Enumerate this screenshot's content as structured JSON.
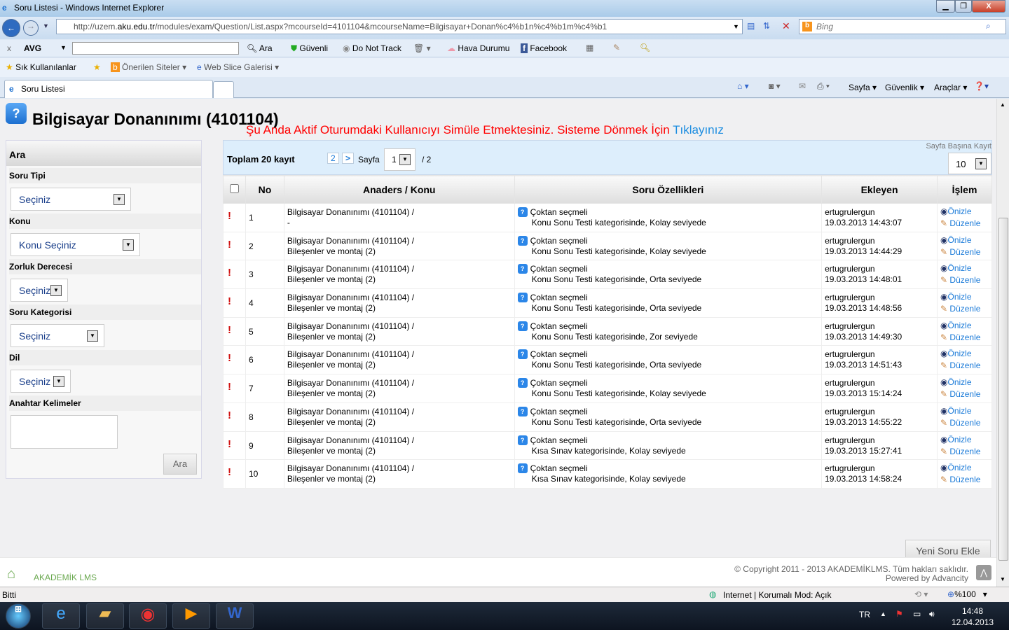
{
  "window": {
    "title": "Soru Listesi - Windows Internet Explorer",
    "url_pre": "http://uzem.",
    "url_host": "aku.edu.tr",
    "url_post": "/modules/exam/Question/List.aspx?mcourseId=4101104&mcourseName=Bilgisayar+Donan%c4%b1n%c4%b1m%c4%b1",
    "search_placeholder": "Bing"
  },
  "avgbar": {
    "close": "x",
    "brand": "AVG",
    "search": "Ara",
    "safe": "Güvenli",
    "dnt": "Do Not Track",
    "weather": "Hava Durumu",
    "facebook": "Facebook"
  },
  "favbar": {
    "favorites": "Sık Kullanılanlar",
    "suggested": "Önerilen Siteler",
    "webslice": "Web Slice Galerisi"
  },
  "tabbar": {
    "tab": "Soru Listesi",
    "page": "Sayfa",
    "security": "Güvenlik",
    "tools": "Araçlar"
  },
  "page": {
    "title": "Bilgisayar Donanınımı (4101104)",
    "warning": "Şu Anda Aktif Oturumdaki Kullanıcıyı Simüle Etmektesiniz. Sisteme Dönmek İçin ",
    "warning_link": "Tıklayınız"
  },
  "search": {
    "header": "Ara",
    "fields": [
      {
        "label": "Soru Tipi",
        "value": "Seçiniz"
      },
      {
        "label": "Konu",
        "value": "Konu Seçiniz"
      },
      {
        "label": "Zorluk Derecesi",
        "value": "Seçiniz"
      },
      {
        "label": "Soru Kategorisi",
        "value": "Seçiniz"
      },
      {
        "label": "Dil",
        "value": "Seçiniz"
      }
    ],
    "keywords_label": "Anahtar Kelimeler",
    "keywords_value": "",
    "button": "Ara"
  },
  "pager": {
    "total": "Toplam 20 kayıt",
    "page_link": "2",
    "next": ">",
    "page_label": "Sayfa",
    "current_page": "1",
    "of": "/ 2",
    "per_page_label": "Sayfa Başına Kayıt",
    "per_page": "10"
  },
  "table": {
    "headers": [
      "No",
      "Anaders / Konu",
      "Soru Özellikleri",
      "Ekleyen",
      "İşlem"
    ],
    "rows": [
      {
        "no": "1",
        "course": "Bilgisayar Donanınımı (4101104) /",
        "topic": "-",
        "type": "Çoktan seçmeli",
        "props": "Konu Sonu Testi kategorisinde, Kolay seviyede",
        "user": "ertugrulergun",
        "date": "19.03.2013 14:43:07"
      },
      {
        "no": "2",
        "course": "Bilgisayar Donanınımı (4101104) /",
        "topic": "Bileşenler ve montaj (2)",
        "type": "Çoktan seçmeli",
        "props": "Konu Sonu Testi kategorisinde, Kolay seviyede",
        "user": "ertugrulergun",
        "date": "19.03.2013 14:44:29"
      },
      {
        "no": "3",
        "course": "Bilgisayar Donanınımı (4101104) /",
        "topic": "Bileşenler ve montaj (2)",
        "type": "Çoktan seçmeli",
        "props": "Konu Sonu Testi kategorisinde, Orta seviyede",
        "user": "ertugrulergun",
        "date": "19.03.2013 14:48:01"
      },
      {
        "no": "4",
        "course": "Bilgisayar Donanınımı (4101104) /",
        "topic": "Bileşenler ve montaj (2)",
        "type": "Çoktan seçmeli",
        "props": "Konu Sonu Testi kategorisinde, Orta seviyede",
        "user": "ertugrulergun",
        "date": "19.03.2013 14:48:56"
      },
      {
        "no": "5",
        "course": "Bilgisayar Donanınımı (4101104) /",
        "topic": "Bileşenler ve montaj (2)",
        "type": "Çoktan seçmeli",
        "props": "Konu Sonu Testi kategorisinde, Zor seviyede",
        "user": "ertugrulergun",
        "date": "19.03.2013 14:49:30"
      },
      {
        "no": "6",
        "course": "Bilgisayar Donanınımı (4101104) /",
        "topic": "Bileşenler ve montaj (2)",
        "type": "Çoktan seçmeli",
        "props": "Konu Sonu Testi kategorisinde, Orta seviyede",
        "user": "ertugrulergun",
        "date": "19.03.2013 14:51:43"
      },
      {
        "no": "7",
        "course": "Bilgisayar Donanınımı (4101104) /",
        "topic": "Bileşenler ve montaj (2)",
        "type": "Çoktan seçmeli",
        "props": "Konu Sonu Testi kategorisinde, Kolay seviyede",
        "user": "ertugrulergun",
        "date": "19.03.2013 15:14:24"
      },
      {
        "no": "8",
        "course": "Bilgisayar Donanınımı (4101104) /",
        "topic": "Bileşenler ve montaj (2)",
        "type": "Çoktan seçmeli",
        "props": "Konu Sonu Testi kategorisinde, Orta seviyede",
        "user": "ertugrulergun",
        "date": "19.03.2013 14:55:22"
      },
      {
        "no": "9",
        "course": "Bilgisayar Donanınımı (4101104) /",
        "topic": "Bileşenler ve montaj (2)",
        "type": "Çoktan seçmeli",
        "props": "Kısa Sınav kategorisinde, Kolay seviyede",
        "user": "ertugrulergun",
        "date": "19.03.2013 15:27:41"
      },
      {
        "no": "10",
        "course": "Bilgisayar Donanınımı (4101104) /",
        "topic": "Bileşenler ve montaj (2)",
        "type": "Çoktan seçmeli",
        "props": "Kısa Sınav kategorisinde, Kolay seviyede",
        "user": "ertugrulergun",
        "date": "19.03.2013 14:58:24"
      }
    ],
    "preview": "Önizle",
    "edit": "Düzenle"
  },
  "add_button": "Yeni Soru Ekle",
  "footer": {
    "logo": "AKADEMİK LMS",
    "copyright": "© Copyright 2011 - 2013 AKADEMİKLMS. Tüm hakları saklıdır.",
    "powered": "Powered by Advancity"
  },
  "status": {
    "text": "Bitti",
    "zone": "Internet | Korumalı Mod: Açık",
    "zoom": "%100"
  },
  "taskbar": {
    "lang": "TR",
    "time": "14:48",
    "date": "12.04.2013"
  },
  "colors": {
    "warning": "#ff0000",
    "link": "#1a7ad8",
    "pager_bg": "#ddeefc"
  }
}
